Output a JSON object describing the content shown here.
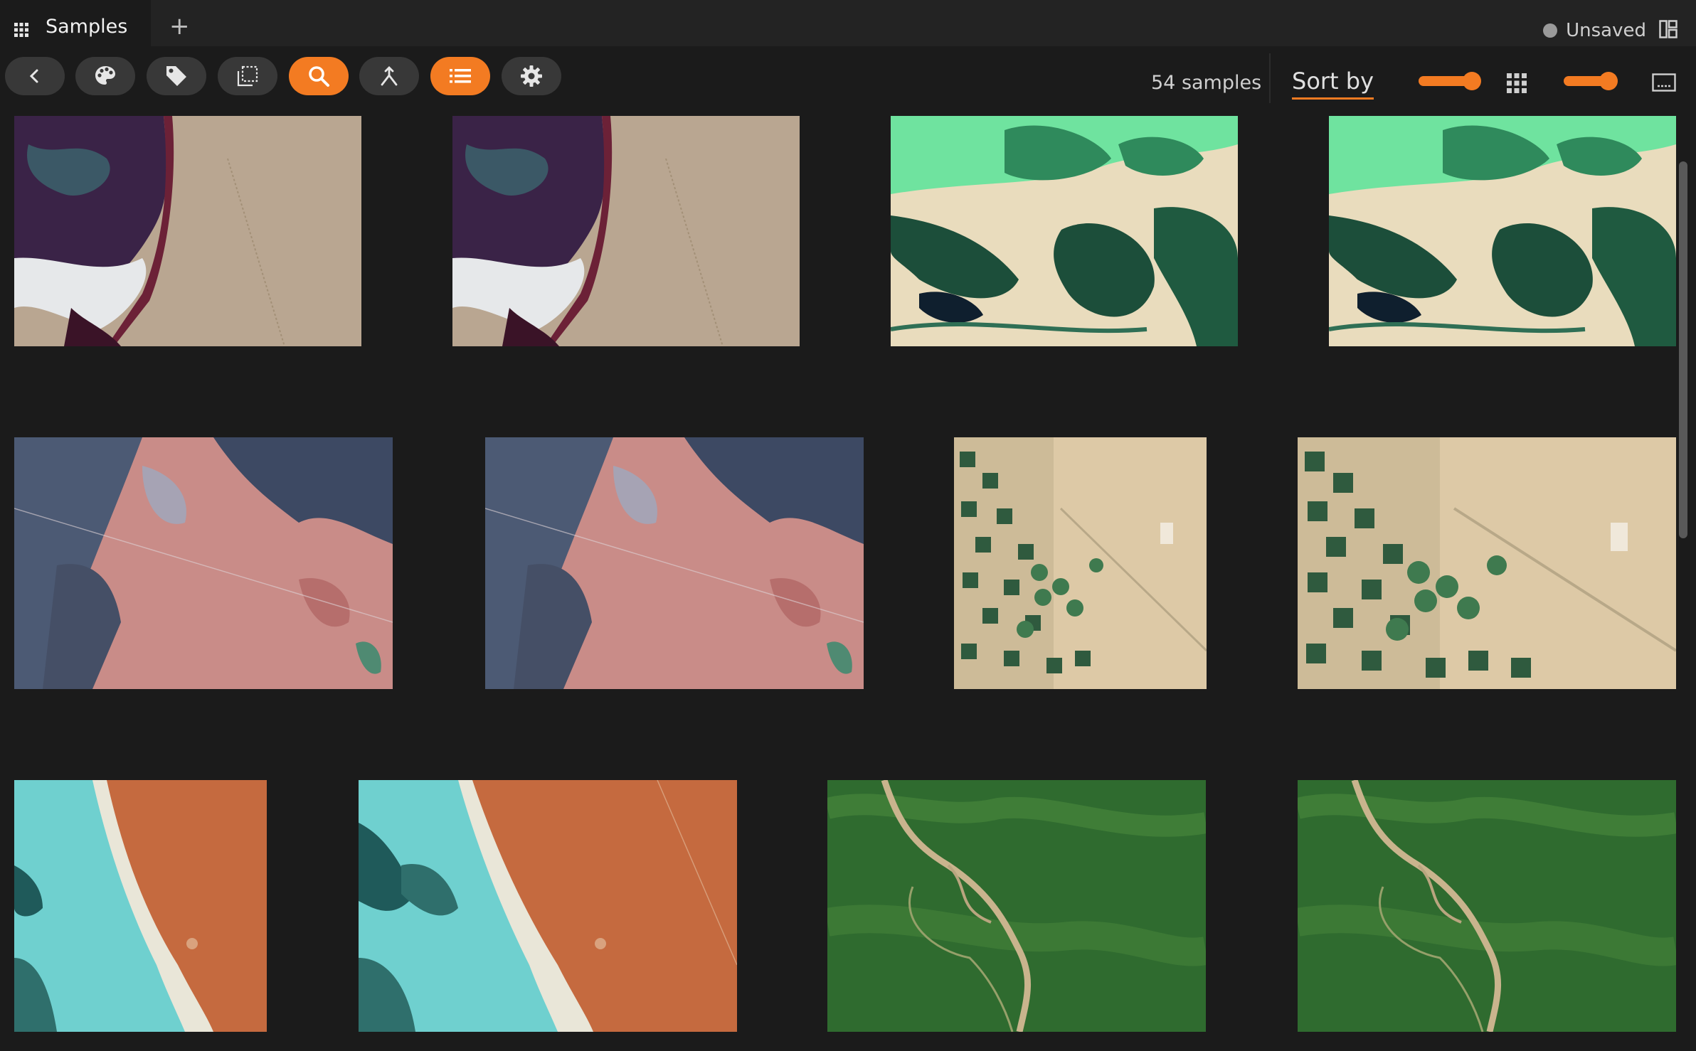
{
  "tabbar": {
    "tab_label": "Samples",
    "add_tab_glyph": "+",
    "status_text": "Unsaved"
  },
  "toolbar": {
    "buttons": [
      {
        "name": "back-button",
        "icon": "chevron-left-icon",
        "active": false
      },
      {
        "name": "color-scheme-button",
        "icon": "palette-icon",
        "active": false
      },
      {
        "name": "tag-button",
        "icon": "tag-icon",
        "active": false
      },
      {
        "name": "select-region-button",
        "icon": "selection-icon",
        "active": false
      },
      {
        "name": "search-button",
        "icon": "search-icon",
        "active": true
      },
      {
        "name": "merge-button",
        "icon": "merge-icon",
        "active": false
      },
      {
        "name": "list-button",
        "icon": "list-icon",
        "active": true
      },
      {
        "name": "settings-button",
        "icon": "gear-icon",
        "active": false
      }
    ],
    "sample_count": "54 samples",
    "sort_label": "Sort by",
    "accent_color": "#f37b22"
  },
  "gallery": {
    "samples": [
      {
        "name": "sample-1",
        "palette": "salt-lake"
      },
      {
        "name": "sample-2",
        "palette": "salt-lake"
      },
      {
        "name": "sample-3",
        "palette": "green-lake"
      },
      {
        "name": "sample-4",
        "palette": "green-lake"
      },
      {
        "name": "sample-5",
        "palette": "pink-fields"
      },
      {
        "name": "sample-6",
        "palette": "pink-fields"
      },
      {
        "name": "sample-7",
        "palette": "desert-farms"
      },
      {
        "name": "sample-8",
        "palette": "desert-farms"
      },
      {
        "name": "sample-9",
        "palette": "turquoise-river"
      },
      {
        "name": "sample-10",
        "palette": "turquoise-river"
      },
      {
        "name": "sample-11",
        "palette": "green-forest-river"
      },
      {
        "name": "sample-12",
        "palette": "green-forest-river"
      }
    ]
  }
}
